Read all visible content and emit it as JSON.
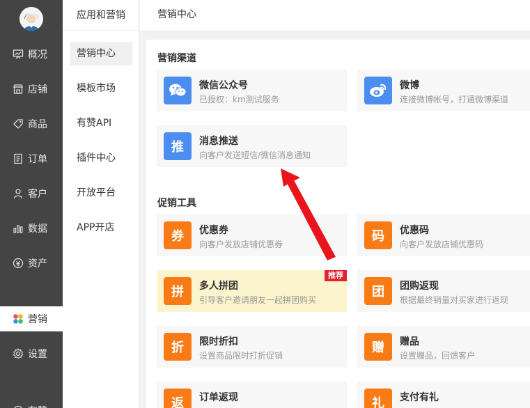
{
  "nav": {
    "items": [
      {
        "label": "概况",
        "icon": "overview-icon"
      },
      {
        "label": "店铺",
        "icon": "store-icon"
      },
      {
        "label": "商品",
        "icon": "tag-icon"
      },
      {
        "label": "订单",
        "icon": "order-icon"
      },
      {
        "label": "客户",
        "icon": "customer-icon"
      },
      {
        "label": "数据",
        "icon": "data-icon"
      },
      {
        "label": "资产",
        "icon": "asset-icon"
      },
      {
        "label": "营销",
        "icon": "marketing-icon"
      },
      {
        "label": "设置",
        "icon": "settings-icon"
      },
      {
        "label": "有赞",
        "icon": "youzan-icon"
      }
    ],
    "active": "营销"
  },
  "subnav": {
    "title": "应用和营销",
    "items": [
      "营销中心",
      "模板市场",
      "有赞API",
      "插件中心",
      "开放平台",
      "APP开店"
    ],
    "active": "营销中心"
  },
  "header": {
    "title": "营销中心"
  },
  "channels": {
    "title": "营销渠道",
    "tiles": [
      {
        "title": "微信公众号",
        "desc": "已授权：km测试服务",
        "icon": "wechat-icon"
      },
      {
        "title": "微博",
        "desc": "连接微博帐号，打通微博渠道",
        "icon": "weibo-icon"
      },
      {
        "title": "消息推送",
        "desc": "向客户发送短信/微信消息通知",
        "icon_char": "推"
      }
    ]
  },
  "promo": {
    "title": "促销工具",
    "tiles": [
      {
        "title": "优惠券",
        "desc": "向客户发放店铺优惠券",
        "icon_char": "券"
      },
      {
        "title": "优惠码",
        "desc": "向客户发放店铺优惠码",
        "icon_char": "码"
      },
      {
        "title": "多人拼团",
        "desc": "引导客户邀请朋友一起拼团购买",
        "icon_char": "拼",
        "badge": "推荐"
      },
      {
        "title": "团购返现",
        "desc": "根据最终销量对买家进行返现",
        "icon_char": "团"
      },
      {
        "title": "限时折扣",
        "desc": "设置商品限时打折促销",
        "icon_char": "折"
      },
      {
        "title": "赠品",
        "desc": "设置赠品，回馈客户",
        "icon_char": "赠"
      },
      {
        "title": "订单返现",
        "desc": "",
        "icon_char": "返"
      },
      {
        "title": "支付有礼",
        "desc": "",
        "icon_char": "礼"
      }
    ]
  },
  "colors": {
    "orange": "#f97b15",
    "blue": "#4b8ef0",
    "badge": "#e0232e",
    "highlight": "#fcf4cc",
    "arrow": "#e8161c"
  }
}
